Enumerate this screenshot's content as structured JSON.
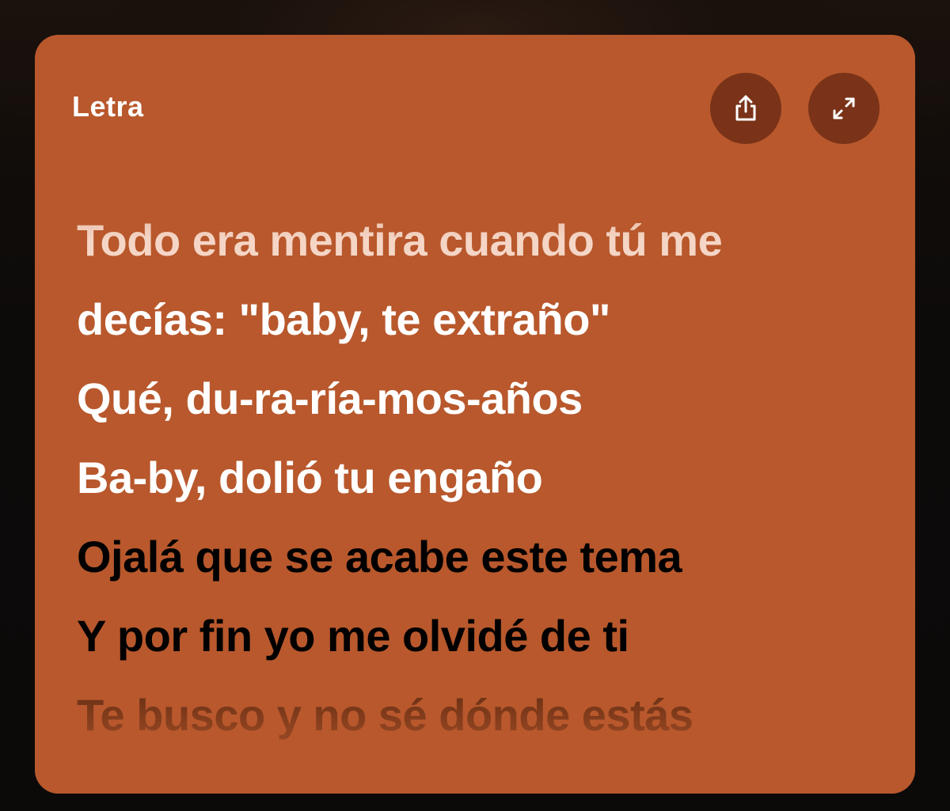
{
  "panel": {
    "title": "Letra",
    "share_icon": "share-icon",
    "expand_icon": "expand-icon",
    "background_color": "#b8582c",
    "button_color": "#7a3318"
  },
  "lyrics": [
    {
      "text": "Todo era mentira cuando tú me",
      "state": "past"
    },
    {
      "text": "decías: \"baby, te extraño\"",
      "state": "past"
    },
    {
      "text": "Qué, du-ra-ría-mos-años",
      "state": "past"
    },
    {
      "text": "Ba-by, dolió tu engaño",
      "state": "past"
    },
    {
      "text": "Ojalá que se acabe este tema",
      "state": "upcoming"
    },
    {
      "text": "Y por fin yo me olvidé de ti",
      "state": "upcoming"
    },
    {
      "text": "Te busco y no sé dónde estás",
      "state": "upcoming"
    }
  ]
}
